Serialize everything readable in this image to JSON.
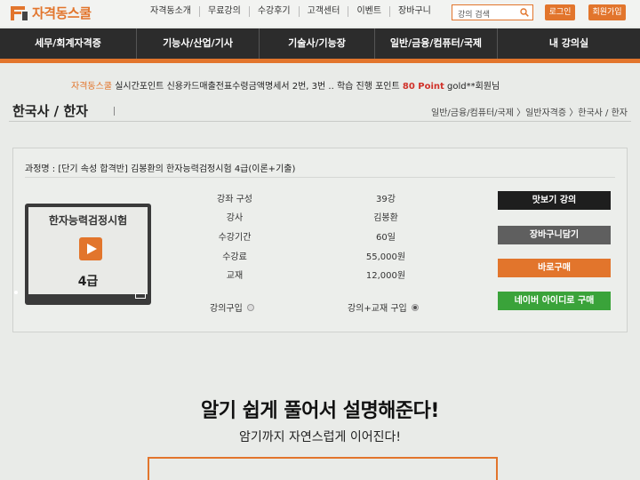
{
  "brand": {
    "name": "자격동스쿨",
    "color": "#e2752c"
  },
  "top_menu": [
    "자격동소개",
    "무료강의",
    "수강후기",
    "고객센터",
    "이벤트",
    "장바구니"
  ],
  "search": {
    "placeholder": "강의 검색",
    "icon": "search-icon"
  },
  "auth": {
    "login": "로그인",
    "join": "회원가입"
  },
  "main_nav": [
    "세무/회계자격증",
    "기능사/산업/기사",
    "기술사/기능장",
    "일반/금융/컴퓨터/국제",
    "내 강의실"
  ],
  "ticker": {
    "brand": "자격동스쿨",
    "text": "실시간포인트 신용카드매출전표수령금액명세서 2번, 3번 .. 학습 진행 포인트",
    "points": "80 Point",
    "user": "gold**회원님"
  },
  "page": {
    "title": "한국사 / 한자",
    "breadcrumb": "일반/금융/컴퓨터/국제 〉일반자격증 〉한국사 / 한자"
  },
  "course": {
    "name": "과정명 : [단기 속성 합격반] 김봉환의 한자능력검정시험 4급(이론+기출)",
    "thumbnail": {
      "title": "한자능력검정시험",
      "grade": "4급",
      "icon": "play-icon"
    },
    "info": [
      {
        "label": "강좌 구성",
        "value": "39강"
      },
      {
        "label": "강사",
        "value": "김봉환"
      },
      {
        "label": "수강기간",
        "value": "60일"
      },
      {
        "label": "수강료",
        "value": "55,000원"
      },
      {
        "label": "교재",
        "value": "12,000원"
      }
    ],
    "purchase_options": [
      {
        "label": "강의구입",
        "selected": false
      },
      {
        "label": "강의+교재 구입",
        "selected": true
      }
    ],
    "buttons": [
      {
        "label": "맛보기 강의",
        "color": "#1e1e1e"
      },
      {
        "label": "장바구니담기",
        "color": "#5f5f5f"
      },
      {
        "label": "바로구매",
        "color": "#e2752c"
      },
      {
        "label": "네이버 아이디로 구매",
        "color": "#3aa33a"
      }
    ]
  },
  "promo": {
    "headline": "알기 쉽게 풀어서 설명해준다!",
    "sub": "암기까지 자연스럽게 이어진다!"
  }
}
